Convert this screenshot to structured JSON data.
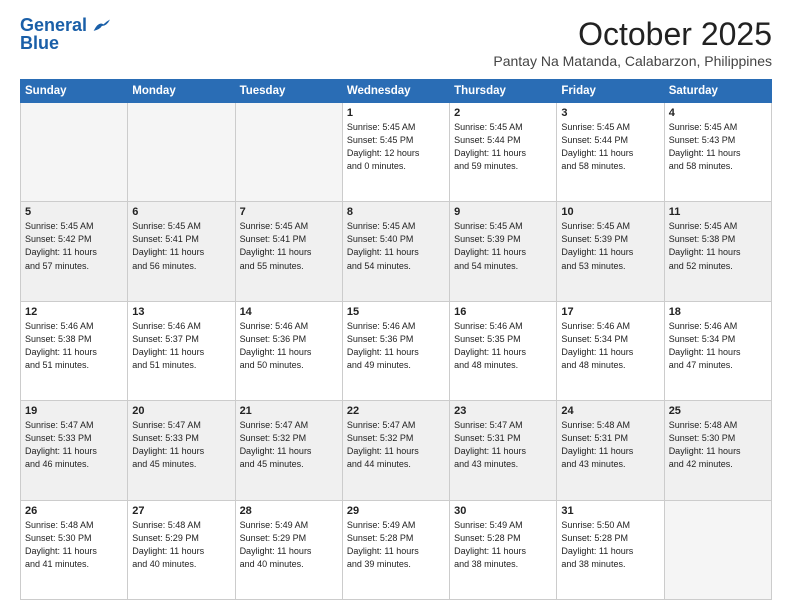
{
  "logo": {
    "general": "General",
    "blue": "Blue"
  },
  "header": {
    "month": "October 2025",
    "subtitle": "Pantay Na Matanda, Calabarzon, Philippines"
  },
  "weekdays": [
    "Sunday",
    "Monday",
    "Tuesday",
    "Wednesday",
    "Thursday",
    "Friday",
    "Saturday"
  ],
  "weeks": [
    [
      {
        "day": "",
        "info": ""
      },
      {
        "day": "",
        "info": ""
      },
      {
        "day": "",
        "info": ""
      },
      {
        "day": "1",
        "info": "Sunrise: 5:45 AM\nSunset: 5:45 PM\nDaylight: 12 hours\nand 0 minutes."
      },
      {
        "day": "2",
        "info": "Sunrise: 5:45 AM\nSunset: 5:44 PM\nDaylight: 11 hours\nand 59 minutes."
      },
      {
        "day": "3",
        "info": "Sunrise: 5:45 AM\nSunset: 5:44 PM\nDaylight: 11 hours\nand 58 minutes."
      },
      {
        "day": "4",
        "info": "Sunrise: 5:45 AM\nSunset: 5:43 PM\nDaylight: 11 hours\nand 58 minutes."
      }
    ],
    [
      {
        "day": "5",
        "info": "Sunrise: 5:45 AM\nSunset: 5:42 PM\nDaylight: 11 hours\nand 57 minutes."
      },
      {
        "day": "6",
        "info": "Sunrise: 5:45 AM\nSunset: 5:41 PM\nDaylight: 11 hours\nand 56 minutes."
      },
      {
        "day": "7",
        "info": "Sunrise: 5:45 AM\nSunset: 5:41 PM\nDaylight: 11 hours\nand 55 minutes."
      },
      {
        "day": "8",
        "info": "Sunrise: 5:45 AM\nSunset: 5:40 PM\nDaylight: 11 hours\nand 54 minutes."
      },
      {
        "day": "9",
        "info": "Sunrise: 5:45 AM\nSunset: 5:39 PM\nDaylight: 11 hours\nand 54 minutes."
      },
      {
        "day": "10",
        "info": "Sunrise: 5:45 AM\nSunset: 5:39 PM\nDaylight: 11 hours\nand 53 minutes."
      },
      {
        "day": "11",
        "info": "Sunrise: 5:45 AM\nSunset: 5:38 PM\nDaylight: 11 hours\nand 52 minutes."
      }
    ],
    [
      {
        "day": "12",
        "info": "Sunrise: 5:46 AM\nSunset: 5:38 PM\nDaylight: 11 hours\nand 51 minutes."
      },
      {
        "day": "13",
        "info": "Sunrise: 5:46 AM\nSunset: 5:37 PM\nDaylight: 11 hours\nand 51 minutes."
      },
      {
        "day": "14",
        "info": "Sunrise: 5:46 AM\nSunset: 5:36 PM\nDaylight: 11 hours\nand 50 minutes."
      },
      {
        "day": "15",
        "info": "Sunrise: 5:46 AM\nSunset: 5:36 PM\nDaylight: 11 hours\nand 49 minutes."
      },
      {
        "day": "16",
        "info": "Sunrise: 5:46 AM\nSunset: 5:35 PM\nDaylight: 11 hours\nand 48 minutes."
      },
      {
        "day": "17",
        "info": "Sunrise: 5:46 AM\nSunset: 5:34 PM\nDaylight: 11 hours\nand 48 minutes."
      },
      {
        "day": "18",
        "info": "Sunrise: 5:46 AM\nSunset: 5:34 PM\nDaylight: 11 hours\nand 47 minutes."
      }
    ],
    [
      {
        "day": "19",
        "info": "Sunrise: 5:47 AM\nSunset: 5:33 PM\nDaylight: 11 hours\nand 46 minutes."
      },
      {
        "day": "20",
        "info": "Sunrise: 5:47 AM\nSunset: 5:33 PM\nDaylight: 11 hours\nand 45 minutes."
      },
      {
        "day": "21",
        "info": "Sunrise: 5:47 AM\nSunset: 5:32 PM\nDaylight: 11 hours\nand 45 minutes."
      },
      {
        "day": "22",
        "info": "Sunrise: 5:47 AM\nSunset: 5:32 PM\nDaylight: 11 hours\nand 44 minutes."
      },
      {
        "day": "23",
        "info": "Sunrise: 5:47 AM\nSunset: 5:31 PM\nDaylight: 11 hours\nand 43 minutes."
      },
      {
        "day": "24",
        "info": "Sunrise: 5:48 AM\nSunset: 5:31 PM\nDaylight: 11 hours\nand 43 minutes."
      },
      {
        "day": "25",
        "info": "Sunrise: 5:48 AM\nSunset: 5:30 PM\nDaylight: 11 hours\nand 42 minutes."
      }
    ],
    [
      {
        "day": "26",
        "info": "Sunrise: 5:48 AM\nSunset: 5:30 PM\nDaylight: 11 hours\nand 41 minutes."
      },
      {
        "day": "27",
        "info": "Sunrise: 5:48 AM\nSunset: 5:29 PM\nDaylight: 11 hours\nand 40 minutes."
      },
      {
        "day": "28",
        "info": "Sunrise: 5:49 AM\nSunset: 5:29 PM\nDaylight: 11 hours\nand 40 minutes."
      },
      {
        "day": "29",
        "info": "Sunrise: 5:49 AM\nSunset: 5:28 PM\nDaylight: 11 hours\nand 39 minutes."
      },
      {
        "day": "30",
        "info": "Sunrise: 5:49 AM\nSunset: 5:28 PM\nDaylight: 11 hours\nand 38 minutes."
      },
      {
        "day": "31",
        "info": "Sunrise: 5:50 AM\nSunset: 5:28 PM\nDaylight: 11 hours\nand 38 minutes."
      },
      {
        "day": "",
        "info": ""
      }
    ]
  ]
}
